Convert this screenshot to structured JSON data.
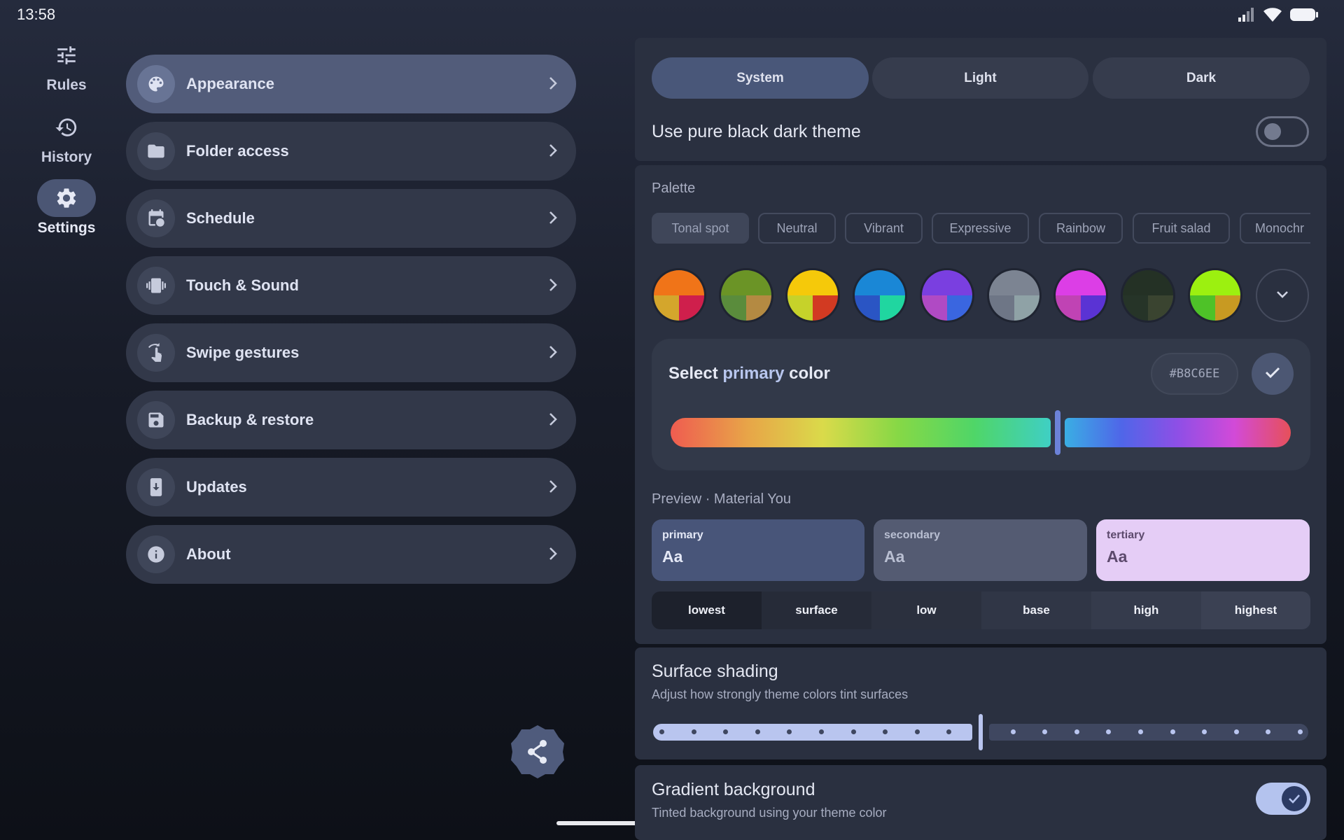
{
  "status": {
    "time": "13:58"
  },
  "rail": [
    {
      "label": "Rules",
      "icon": "tune-icon"
    },
    {
      "label": "History",
      "icon": "history-icon"
    },
    {
      "label": "Settings",
      "icon": "gear-icon"
    }
  ],
  "settings_list": [
    {
      "label": "Appearance",
      "icon": "palette-icon"
    },
    {
      "label": "Folder access",
      "icon": "folder-icon"
    },
    {
      "label": "Schedule",
      "icon": "calendar-clock-icon"
    },
    {
      "label": "Touch & Sound",
      "icon": "vibration-icon"
    },
    {
      "label": "Swipe gestures",
      "icon": "swipe-icon"
    },
    {
      "label": "Backup & restore",
      "icon": "save-icon"
    },
    {
      "label": "Updates",
      "icon": "download-icon"
    },
    {
      "label": "About",
      "icon": "info-icon"
    }
  ],
  "theme_mode": {
    "options": [
      "System",
      "Light",
      "Dark"
    ],
    "selected": "System"
  },
  "pure_black": {
    "label": "Use pure black dark theme",
    "enabled": false
  },
  "palette": {
    "title": "Palette",
    "styles": [
      "Tonal spot",
      "Neutral",
      "Vibrant",
      "Expressive",
      "Rainbow",
      "Fruit salad",
      "Monochr"
    ],
    "selected": "Tonal spot",
    "swatches": [
      {
        "top": "#f07418",
        "bl": "#d4a62c",
        "br": "#cf1f4c"
      },
      {
        "top": "#6b9426",
        "bl": "#5a8c3c",
        "br": "#b48a42"
      },
      {
        "top": "#f5c90a",
        "bl": "#c6d22a",
        "br": "#d23a22"
      },
      {
        "top": "#1a87d6",
        "bl": "#2a55c4",
        "br": "#20d6a0"
      },
      {
        "top": "#7a3fe0",
        "bl": "#b04ac4",
        "br": "#3a66e0"
      },
      {
        "top": "#7c8492",
        "bl": "#6e7686",
        "br": "#8fa2a6"
      },
      {
        "top": "#dc3ee6",
        "bl": "#c043b4",
        "br": "#5a33d4"
      },
      {
        "top": "#243125",
        "bl": "#263428",
        "br": "#3a4430"
      },
      {
        "top": "#9cf010",
        "bl": "#4ec228",
        "br": "#c89a22"
      }
    ]
  },
  "primary_color": {
    "prefix": "Select",
    "accent": "primary",
    "suffix": "color",
    "hex": "#B8C6EE",
    "hue_position": 0.62
  },
  "preview": {
    "title": "Preview · Material You",
    "cards": [
      {
        "label": "primary",
        "sample": "Aa"
      },
      {
        "label": "secondary",
        "sample": "Aa"
      },
      {
        "label": "tertiary",
        "sample": "Aa"
      }
    ],
    "tones": [
      "lowest",
      "surface",
      "low",
      "base",
      "high",
      "highest"
    ]
  },
  "surface_shading": {
    "title": "Surface shading",
    "subtitle": "Adjust how strongly theme colors tint surfaces",
    "level": 0.5
  },
  "gradient_bg": {
    "title": "Gradient background",
    "subtitle": "Tinted background using your theme color",
    "enabled": true
  },
  "colors": {
    "accent": "#b8c6ee"
  }
}
